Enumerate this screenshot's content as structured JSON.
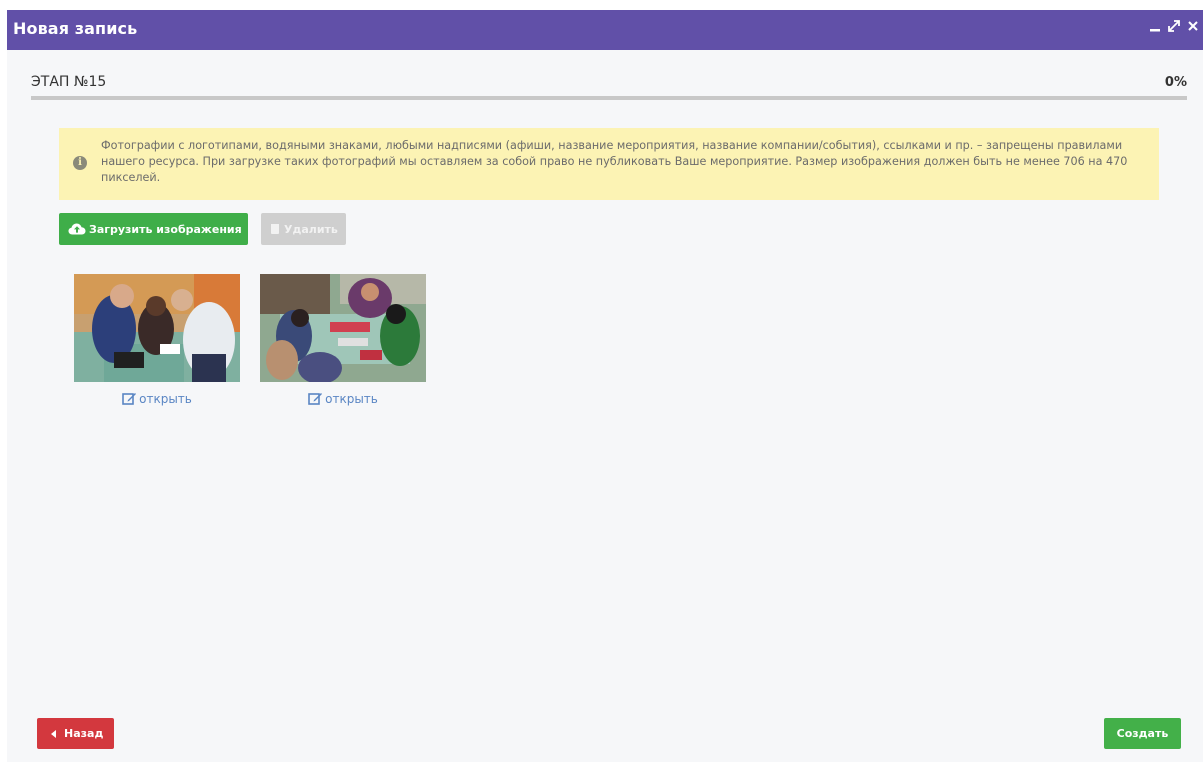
{
  "window": {
    "title": "Новая запись",
    "controls": [
      "minimize-icon",
      "maximize-icon",
      "close-icon"
    ]
  },
  "stage": {
    "label": "ЭТАП №15",
    "progress_label": "0%",
    "progress_value": 0
  },
  "alert": {
    "icon": "info-icon",
    "text": "Фотографии с логотипами, водяными знаками, любыми надписями (афиши, название мероприятия, название компании/события), ссылками и пр. – запрещены правилами нашего ресурса. При загрузке таких фотографий мы оставляем за собой право не публиковать Ваше мероприятие. Размер изображения должен быть не менее 706 на 470 пикселей."
  },
  "toolbar": {
    "upload_label": "Загрузить изображения",
    "delete_label": "Удалить"
  },
  "images": [
    {
      "open_label": "открыть"
    },
    {
      "open_label": "открыть"
    }
  ],
  "footer": {
    "back_label": "Назад",
    "create_label": "Создать"
  },
  "colors": {
    "header": "#6150a8",
    "alert_bg": "#fcf3b4",
    "upload_button": "#3fae49",
    "delete_button_disabled": "#cfcfcf",
    "back_button": "#d3383e",
    "create_button": "#43b049",
    "link": "#5a86c4"
  }
}
